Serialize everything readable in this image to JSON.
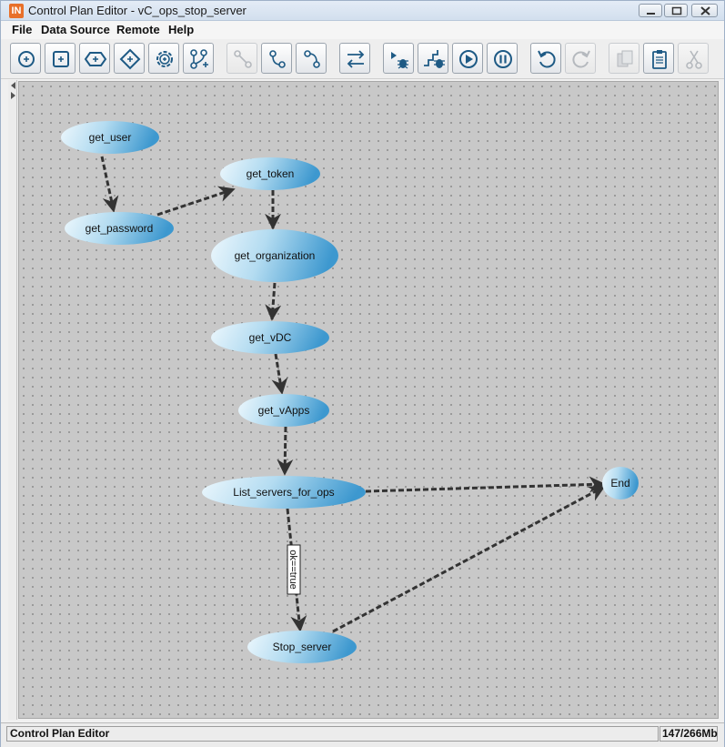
{
  "window": {
    "app_icon": "IN",
    "title": "Control Plan Editor - vC_ops_stop_server"
  },
  "menu": [
    "File",
    "Data Source",
    "Remote",
    "Help"
  ],
  "toolbar": {
    "buttons": [
      {
        "icon": "add-start-node-icon",
        "enabled": true
      },
      {
        "icon": "add-task-node-icon",
        "enabled": true
      },
      {
        "icon": "add-hexagon-node-icon",
        "enabled": true
      },
      {
        "icon": "add-decision-node-icon",
        "enabled": true
      },
      {
        "icon": "add-gear-node-icon",
        "enabled": true
      },
      {
        "icon": "add-branch-icon",
        "enabled": true
      },
      {
        "icon": "link-nodes-icon",
        "enabled": false
      },
      {
        "icon": "connect-nodes-icon",
        "enabled": true
      },
      {
        "icon": "connect-nodes-alt-icon",
        "enabled": true
      },
      {
        "icon": "swap-direction-icon",
        "enabled": true
      },
      {
        "icon": "debug-run-icon",
        "enabled": true
      },
      {
        "icon": "debug-step-icon",
        "enabled": true
      },
      {
        "icon": "play-icon",
        "enabled": true
      },
      {
        "icon": "pause-icon",
        "enabled": true
      },
      {
        "icon": "undo-icon",
        "enabled": true
      },
      {
        "icon": "redo-icon",
        "enabled": false
      },
      {
        "icon": "copy-icon",
        "enabled": false
      },
      {
        "icon": "paste-icon",
        "enabled": true
      },
      {
        "icon": "cut-icon",
        "enabled": false
      }
    ]
  },
  "graph": {
    "nodes": [
      {
        "id": "get_user",
        "label": "get_user"
      },
      {
        "id": "get_password",
        "label": "get_password"
      },
      {
        "id": "get_token",
        "label": "get_token"
      },
      {
        "id": "get_organization",
        "label": "get_organization"
      },
      {
        "id": "get_vDC",
        "label": "get_vDC"
      },
      {
        "id": "get_vApps",
        "label": "get_vApps"
      },
      {
        "id": "List_servers_for_ops",
        "label": "List_servers_for_ops"
      },
      {
        "id": "Stop_server",
        "label": "Stop_server"
      },
      {
        "id": "End",
        "label": "End"
      }
    ],
    "edges": [
      {
        "from": "get_user",
        "to": "get_password",
        "label": ""
      },
      {
        "from": "get_password",
        "to": "get_token",
        "label": ""
      },
      {
        "from": "get_token",
        "to": "get_organization",
        "label": ""
      },
      {
        "from": "get_organization",
        "to": "get_vDC",
        "label": ""
      },
      {
        "from": "get_vDC",
        "to": "get_vApps",
        "label": ""
      },
      {
        "from": "get_vApps",
        "to": "List_servers_for_ops",
        "label": ""
      },
      {
        "from": "List_servers_for_ops",
        "to": "End",
        "label": ""
      },
      {
        "from": "List_servers_for_ops",
        "to": "Stop_server",
        "label": "ok==true"
      },
      {
        "from": "Stop_server",
        "to": "End",
        "label": ""
      }
    ]
  },
  "status": {
    "left": "Control Plan Editor",
    "memory": "147/266Mb"
  },
  "colors": {
    "node_light": "#e8f4fb",
    "node_dark": "#3f9ad1",
    "edge": "#333333",
    "canvas": "#c8c8c8"
  }
}
